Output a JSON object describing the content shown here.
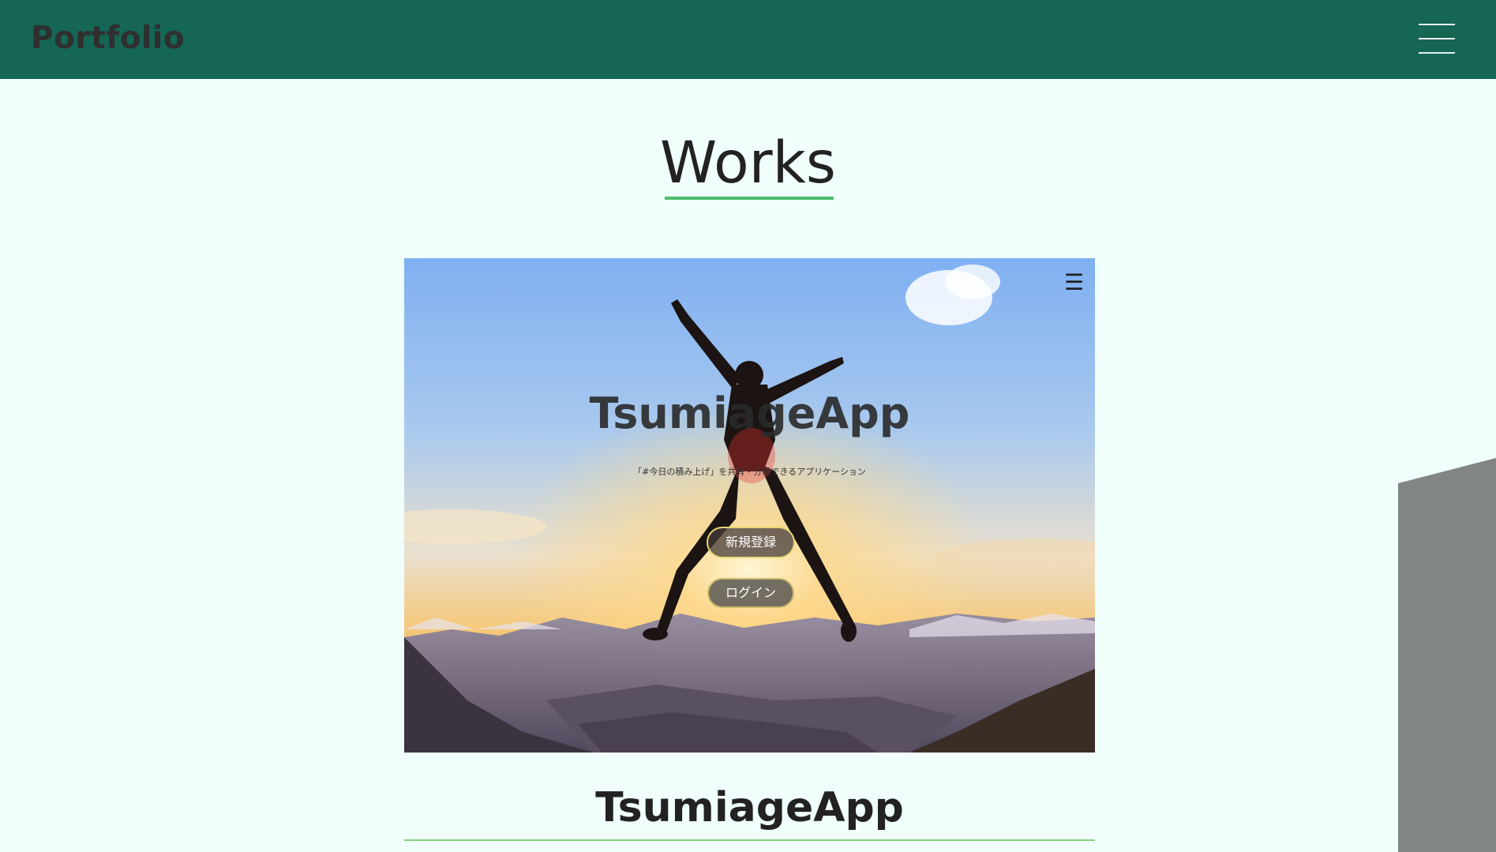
{
  "header": {
    "brand": "Portfolio",
    "menu_icon": "hamburger-menu-icon",
    "background_color": "#156655"
  },
  "section": {
    "title": "Works",
    "accent_color": "#4dbb6b"
  },
  "work_preview": {
    "app_title": "TsumiageApp",
    "subtitle": "「#今日の積み上げ」を共有・分析できるアプリケーション",
    "menu_icon": "☰",
    "signup_label": "新規登録",
    "login_label": "ログイン"
  },
  "work_item": {
    "title": "TsumiageApp"
  }
}
